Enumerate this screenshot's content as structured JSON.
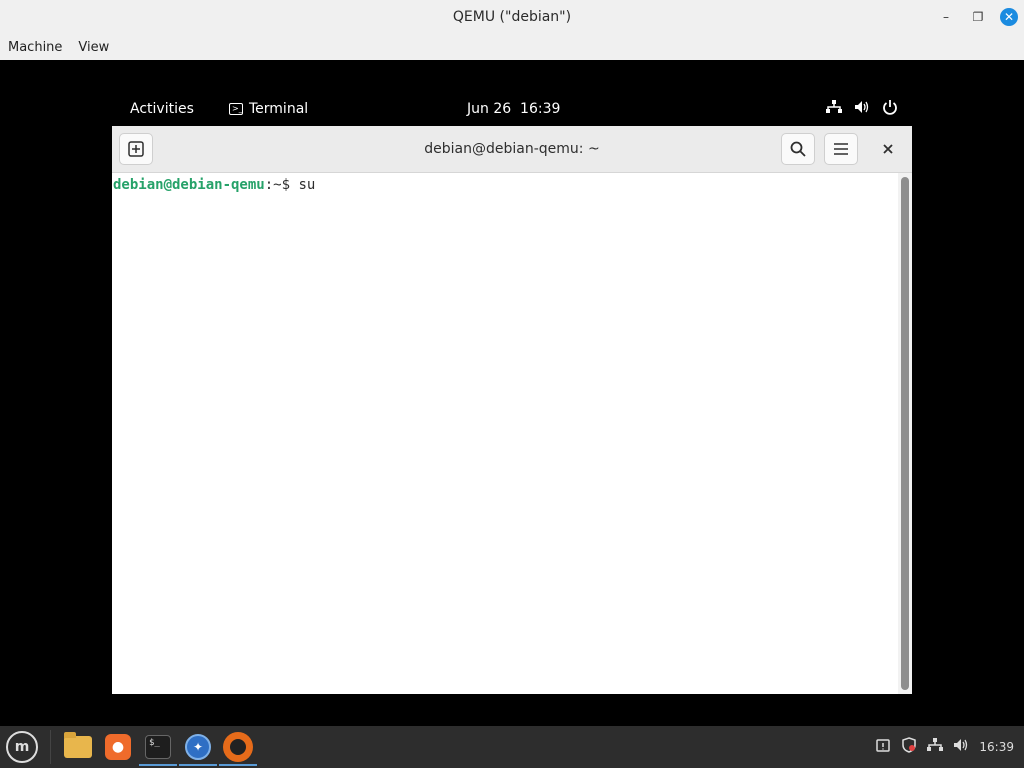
{
  "host": {
    "title": "QEMU (\"debian\")",
    "menu": [
      "Machine",
      "View"
    ],
    "controls": {
      "minimize": "–",
      "maximize": "❐",
      "close": "✕"
    }
  },
  "gnome": {
    "activities": "Activities",
    "app_name": "Terminal",
    "date": "Jun 26",
    "time": "16:39",
    "tray_icons": [
      "network-icon",
      "volume-icon",
      "power-icon"
    ]
  },
  "terminal": {
    "title": "debian@debian-qemu: ~",
    "prompt_user": "debian@debian-qemu",
    "prompt_sep": ":~$",
    "command": "su"
  },
  "taskbar": {
    "menu_label": "m",
    "apps": [
      "files-icon",
      "firefox-icon",
      "terminal-icon",
      "browser-icon",
      "qemu-icon"
    ],
    "time": "16:39"
  },
  "colors": {
    "prompt_green": "#26a269",
    "host_close": "#1b8be0",
    "taskbar_bg": "#2d2d2d"
  }
}
